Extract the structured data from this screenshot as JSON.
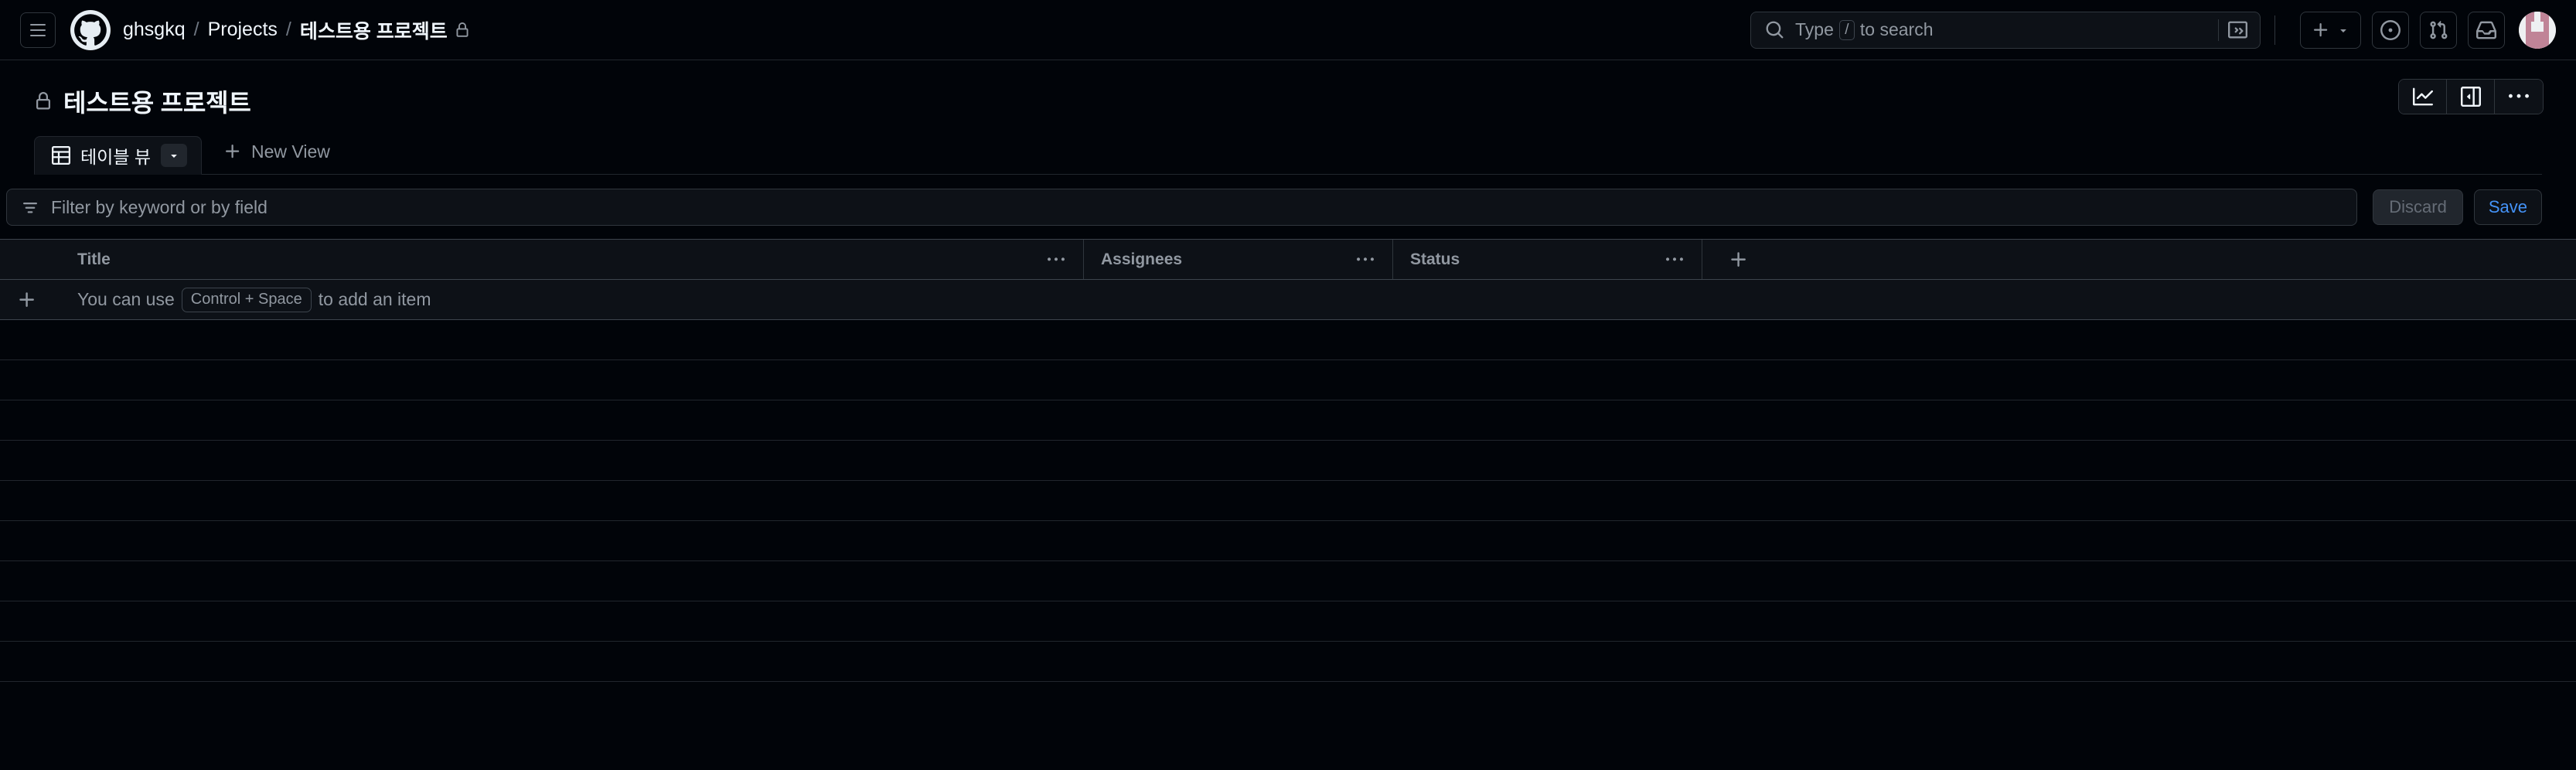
{
  "colors": {
    "canvas": "#010409",
    "surface": "#0d1117",
    "border": "#30363d",
    "muted_text": "#9198a1",
    "accent_blue": "#4493f8",
    "avatar_pink": "#c08497"
  },
  "global_header": {
    "menu_icon": "hamburger-icon",
    "logo_icon": "github-mark-icon",
    "breadcrumb": {
      "owner": "ghsgkq",
      "separator": "/",
      "section": "Projects",
      "current": "테스트용 프로젝트",
      "visibility_icon": "lock-icon"
    },
    "search": {
      "icon": "search-icon",
      "placeholder_before": "Type",
      "placeholder_key": "/",
      "placeholder_after": "to search",
      "command_icon": "terminal-icon"
    },
    "actions": [
      {
        "name": "create-new-menu",
        "icon": "plus-icon",
        "has_caret": true
      },
      {
        "name": "issues-link",
        "icon": "issue-opened-icon",
        "has_caret": false
      },
      {
        "name": "pull-requests-link",
        "icon": "git-pull-request-icon",
        "has_caret": false
      },
      {
        "name": "notifications-inbox",
        "icon": "inbox-icon",
        "has_caret": false
      }
    ],
    "avatar_label": "user-avatar"
  },
  "project": {
    "title": "테스트용 프로젝트",
    "visibility_icon": "lock-icon",
    "header_actions": [
      {
        "name": "insights-button",
        "icon": "graph-icon"
      },
      {
        "name": "toggle-side-panel-button",
        "icon": "side-panel-icon"
      },
      {
        "name": "project-menu-button",
        "icon": "kebab-horizontal-icon"
      }
    ]
  },
  "views": {
    "tabs": [
      {
        "label": "테이블 뷰",
        "icon": "table-icon",
        "active": true,
        "caret_icon": "triangle-down-icon"
      }
    ],
    "new_view": {
      "label": "New View",
      "icon": "plus-icon"
    }
  },
  "filter": {
    "icon": "filter-icon",
    "placeholder": "Filter by keyword or by field",
    "value": "",
    "discard_label": "Discard",
    "save_label": "Save"
  },
  "table": {
    "columns": [
      {
        "label": "Title",
        "menu_icon": "kebab-horizontal-icon"
      },
      {
        "label": "Assignees",
        "menu_icon": "kebab-horizontal-icon"
      },
      {
        "label": "Status",
        "menu_icon": "kebab-horizontal-icon"
      }
    ],
    "add_column": {
      "icon": "plus-icon"
    },
    "add_item_row": {
      "icon": "plus-icon",
      "text_before": "You can use",
      "shortcut": "Control + Space",
      "text_after": "to add an item"
    },
    "rows": [],
    "empty_row_count": 9
  }
}
